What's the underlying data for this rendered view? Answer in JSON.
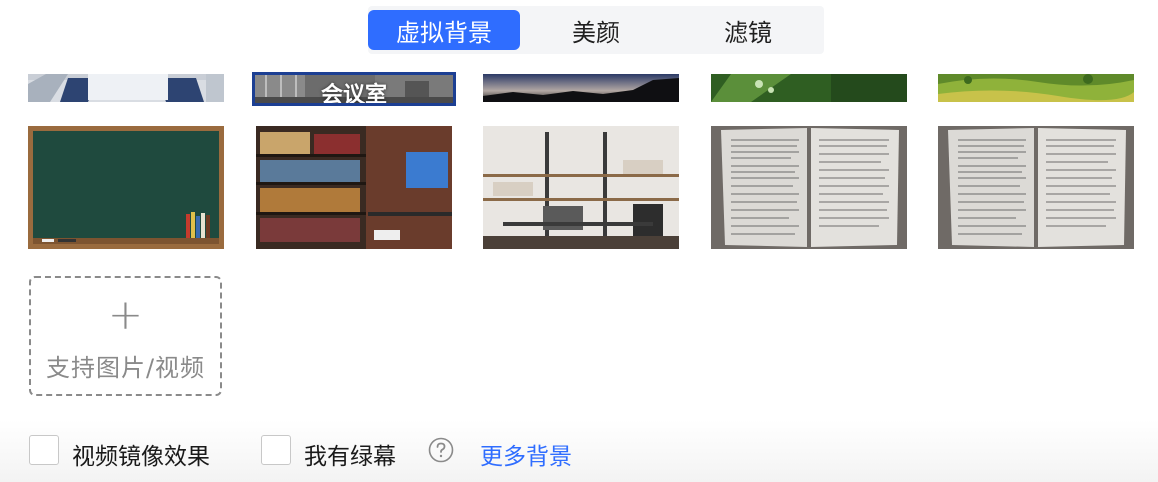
{
  "tabs": [
    {
      "label": "虚拟背景",
      "active": true
    },
    {
      "label": "美颜",
      "active": false
    },
    {
      "label": "滤镜",
      "active": false
    }
  ],
  "backgrounds": {
    "row1": [
      {
        "name": "office-desk"
      },
      {
        "name": "meeting-room",
        "label": "会议室",
        "selected": true
      },
      {
        "name": "night-sky"
      },
      {
        "name": "green-leaf"
      },
      {
        "name": "green-hills"
      }
    ],
    "row2": [
      {
        "name": "blackboard"
      },
      {
        "name": "bookshelf-wall"
      },
      {
        "name": "modern-study"
      },
      {
        "name": "document-1"
      },
      {
        "name": "document-2"
      }
    ]
  },
  "add_card": {
    "icon": "plus-icon",
    "label": "支持图片/视频"
  },
  "options": {
    "mirror_label": "视频镜像效果",
    "mirror_checked": false,
    "green_screen_label": "我有绿幕",
    "green_screen_checked": false,
    "help_icon": "question-circle-icon",
    "more_link": "更多背景"
  },
  "colors": {
    "accent": "#2f6dff",
    "selected_border": "#1c3f93",
    "muted": "#8a8a8a"
  }
}
